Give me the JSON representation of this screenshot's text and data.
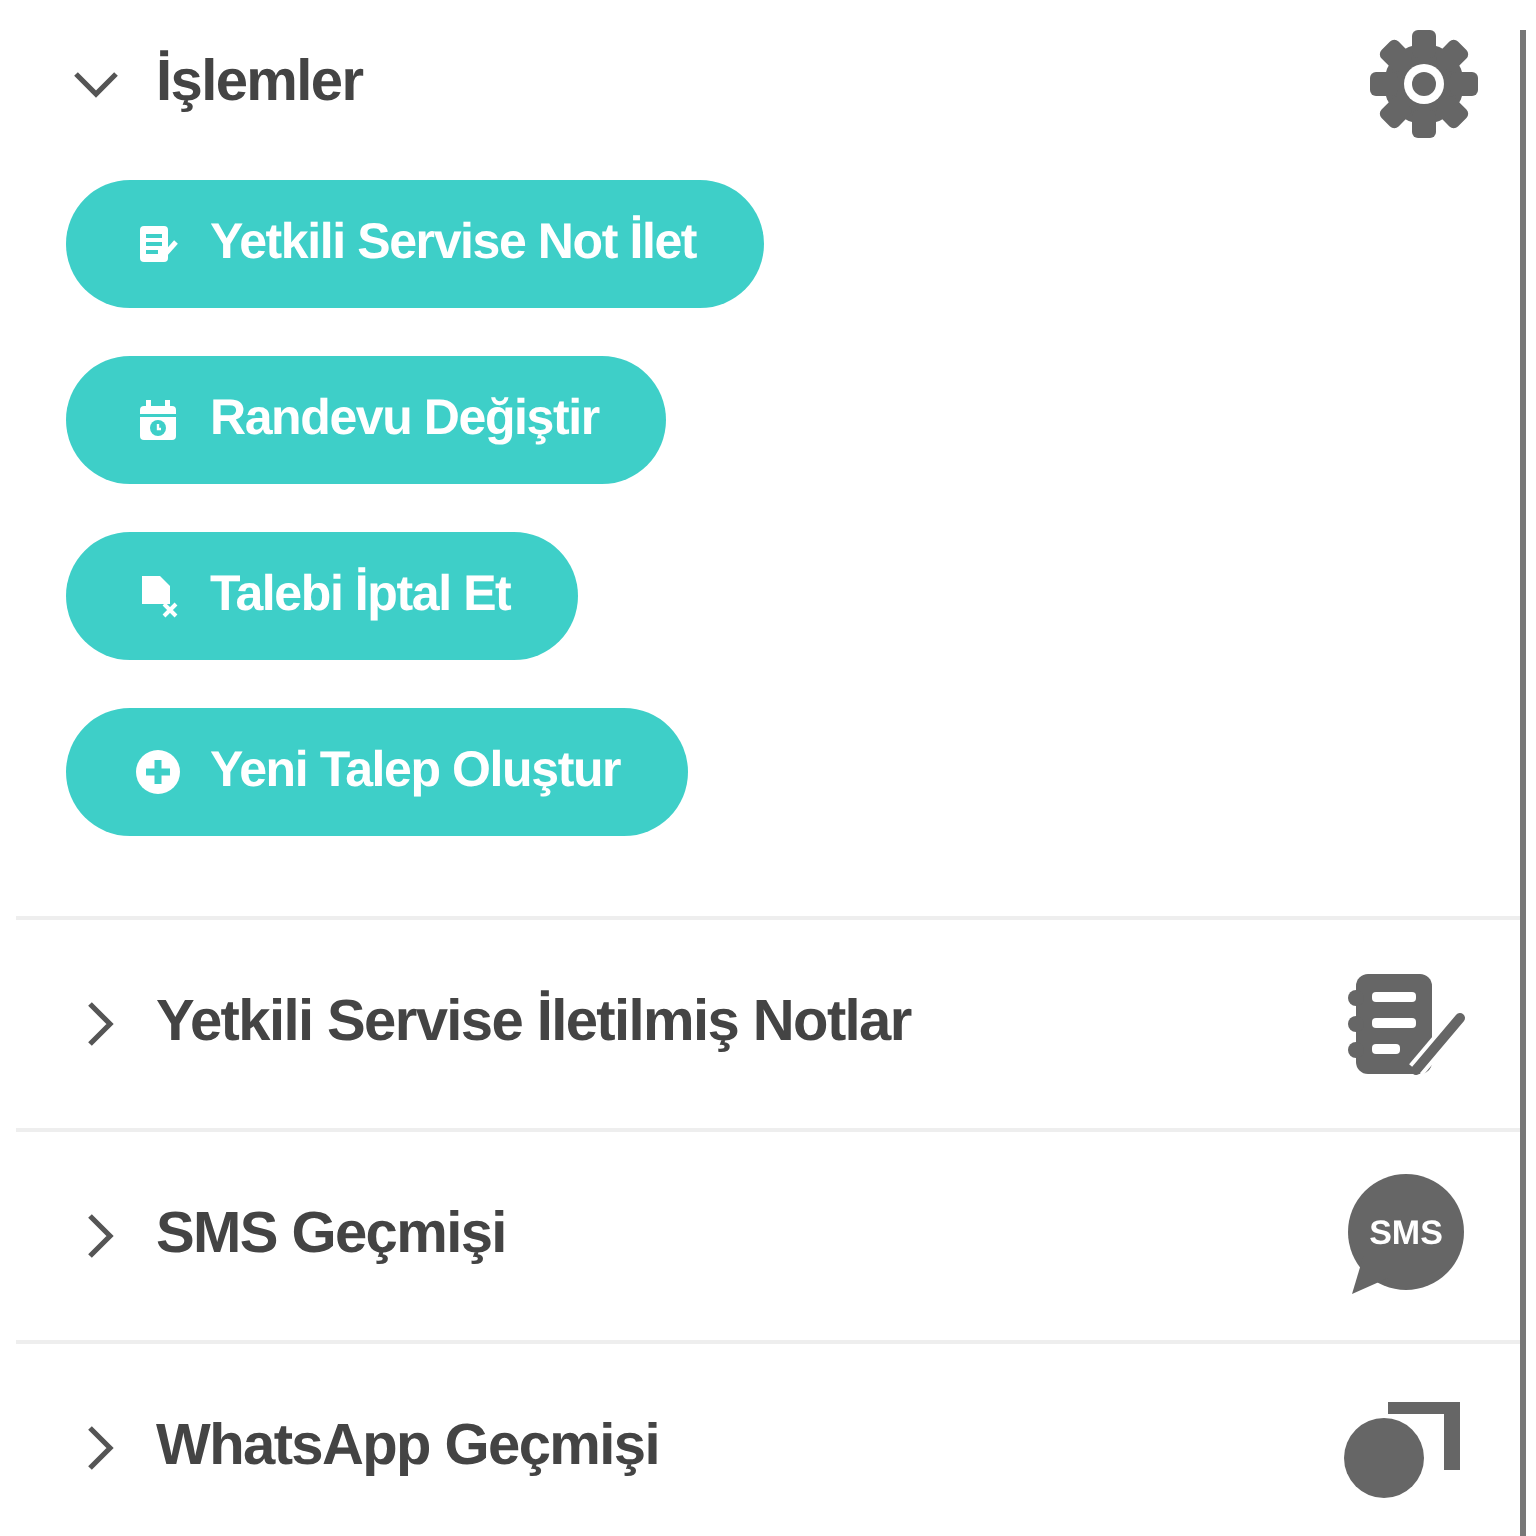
{
  "actions": {
    "title": "İşlemler",
    "expanded": true,
    "buttons": [
      {
        "label": "Yetkili Servise Not İlet",
        "kind": "note"
      },
      {
        "label": "Randevu Değiştir",
        "kind": "calendar"
      },
      {
        "label": "Talebi İptal Et",
        "kind": "cancel"
      },
      {
        "label": "Yeni Talep Oluştur",
        "kind": "add"
      }
    ]
  },
  "sections": [
    {
      "title": "Yetkili Servise İletilmiş Notlar",
      "expanded": false,
      "kind": "note"
    },
    {
      "title": "SMS Geçmişi",
      "expanded": false,
      "kind": "sms",
      "icon_label": "SMS"
    },
    {
      "title": "WhatsApp Geçmişi",
      "expanded": false,
      "kind": "chat"
    }
  ]
}
